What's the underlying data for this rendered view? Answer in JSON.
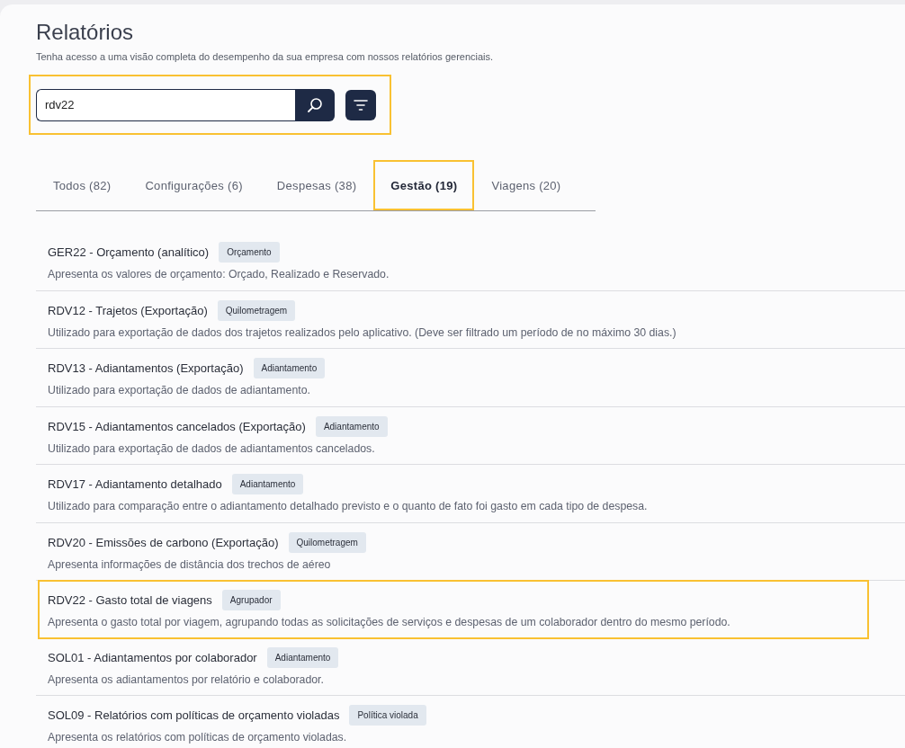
{
  "header": {
    "title": "Relatórios",
    "subtitle": "Tenha acesso a uma visão completa do desempenho da sua empresa com nossos relatórios gerenciais."
  },
  "search": {
    "value": "rdv22",
    "highlighted": true
  },
  "tabs": [
    {
      "label": "Todos (82)",
      "selected": false,
      "highlighted": false
    },
    {
      "label": "Configurações (6)",
      "selected": false,
      "highlighted": false
    },
    {
      "label": "Despesas (38)",
      "selected": false,
      "highlighted": false
    },
    {
      "label": "Gestão (19)",
      "selected": true,
      "highlighted": true
    },
    {
      "label": "Viagens (20)",
      "selected": false,
      "highlighted": false
    }
  ],
  "reports": [
    {
      "title": "GER22 - Orçamento (analítico)",
      "tag": "Orçamento",
      "description": "Apresenta os valores de orçamento: Orçado, Realizado e Reservado.",
      "highlighted": false
    },
    {
      "title": "RDV12 - Trajetos (Exportação)",
      "tag": "Quilometragem",
      "description": "Utilizado para exportação de dados dos trajetos realizados pelo aplicativo. (Deve ser filtrado um período de no máximo 30 dias.)",
      "highlighted": false
    },
    {
      "title": "RDV13 - Adiantamentos (Exportação)",
      "tag": "Adiantamento",
      "description": "Utilizado para exportação de dados de adiantamento.",
      "highlighted": false
    },
    {
      "title": "RDV15 - Adiantamentos cancelados (Exportação)",
      "tag": "Adiantamento",
      "description": "Utilizado para exportação de dados de adiantamentos cancelados.",
      "highlighted": false
    },
    {
      "title": "RDV17 - Adiantamento detalhado",
      "tag": "Adiantamento",
      "description": "Utilizado para comparação entre o adiantamento detalhado previsto e o quanto de fato foi gasto em cada tipo de despesa.",
      "highlighted": false
    },
    {
      "title": "RDV20 - Emissões de carbono (Exportação)",
      "tag": "Quilometragem",
      "description": "Apresenta informações de distância dos trechos de aéreo",
      "highlighted": false
    },
    {
      "title": "RDV22 - Gasto total de viagens",
      "tag": "Agrupador",
      "description": "Apresenta o gasto total por viagem, agrupando todas as solicitações de serviços e despesas de um colaborador dentro do mesmo período.",
      "highlighted": true
    },
    {
      "title": "SOL01 - Adiantamentos por colaborador",
      "tag": "Adiantamento",
      "description": "Apresenta os adiantamentos por relatório e colaborador.",
      "highlighted": false
    },
    {
      "title": "SOL09 - Relatórios com políticas de orçamento violadas",
      "tag": "Política violada",
      "description": "Apresenta os relatórios com políticas de orçamento violadas.",
      "highlighted": false
    }
  ]
}
